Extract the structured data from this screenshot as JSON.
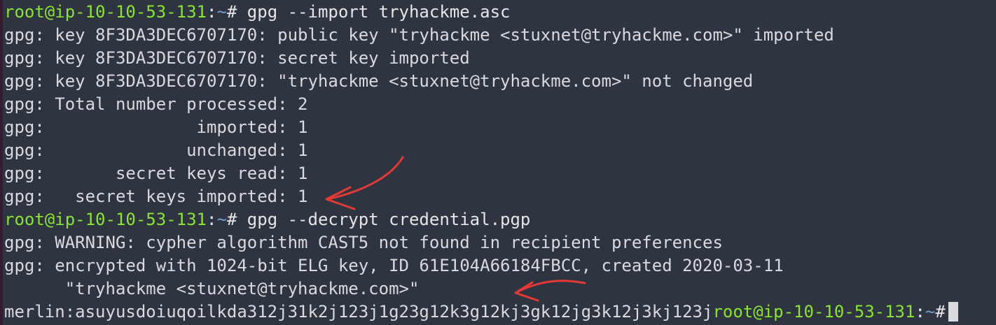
{
  "terminal": {
    "prompt": {
      "user_host": "root@ip-10-10-53-131",
      "colon": ":",
      "path": "~",
      "symbol": "# "
    },
    "commands": {
      "import": "gpg --import tryhackme.asc",
      "decrypt": "gpg --decrypt credential.pgp"
    },
    "output": {
      "l1": "gpg: key 8F3DA3DEC6707170: public key \"tryhackme <stuxnet@tryhackme.com>\" imported",
      "l2": "gpg: key 8F3DA3DEC6707170: secret key imported",
      "l3": "gpg: key 8F3DA3DEC6707170: \"tryhackme <stuxnet@tryhackme.com>\" not changed",
      "l4": "gpg: Total number processed: 2",
      "l5": "gpg:               imported: 1",
      "l6": "gpg:              unchanged: 1",
      "l7": "gpg:       secret keys read: 1",
      "l8": "gpg:   secret keys imported: 1",
      "l9": "gpg: WARNING: cypher algorithm CAST5 not found in recipient preferences",
      "l10": "gpg: encrypted with 1024-bit ELG key, ID 61E104A66184FBCC, created 2020-03-11",
      "l11": "      \"tryhackme <stuxnet@tryhackme.com>\"",
      "l12": "merlin:asuyusdoiuqoilkda312j31k2j123j1g23g12k3g12kj3gk12jg3k12j3kj123j"
    },
    "annotation_color": "#e53935"
  }
}
